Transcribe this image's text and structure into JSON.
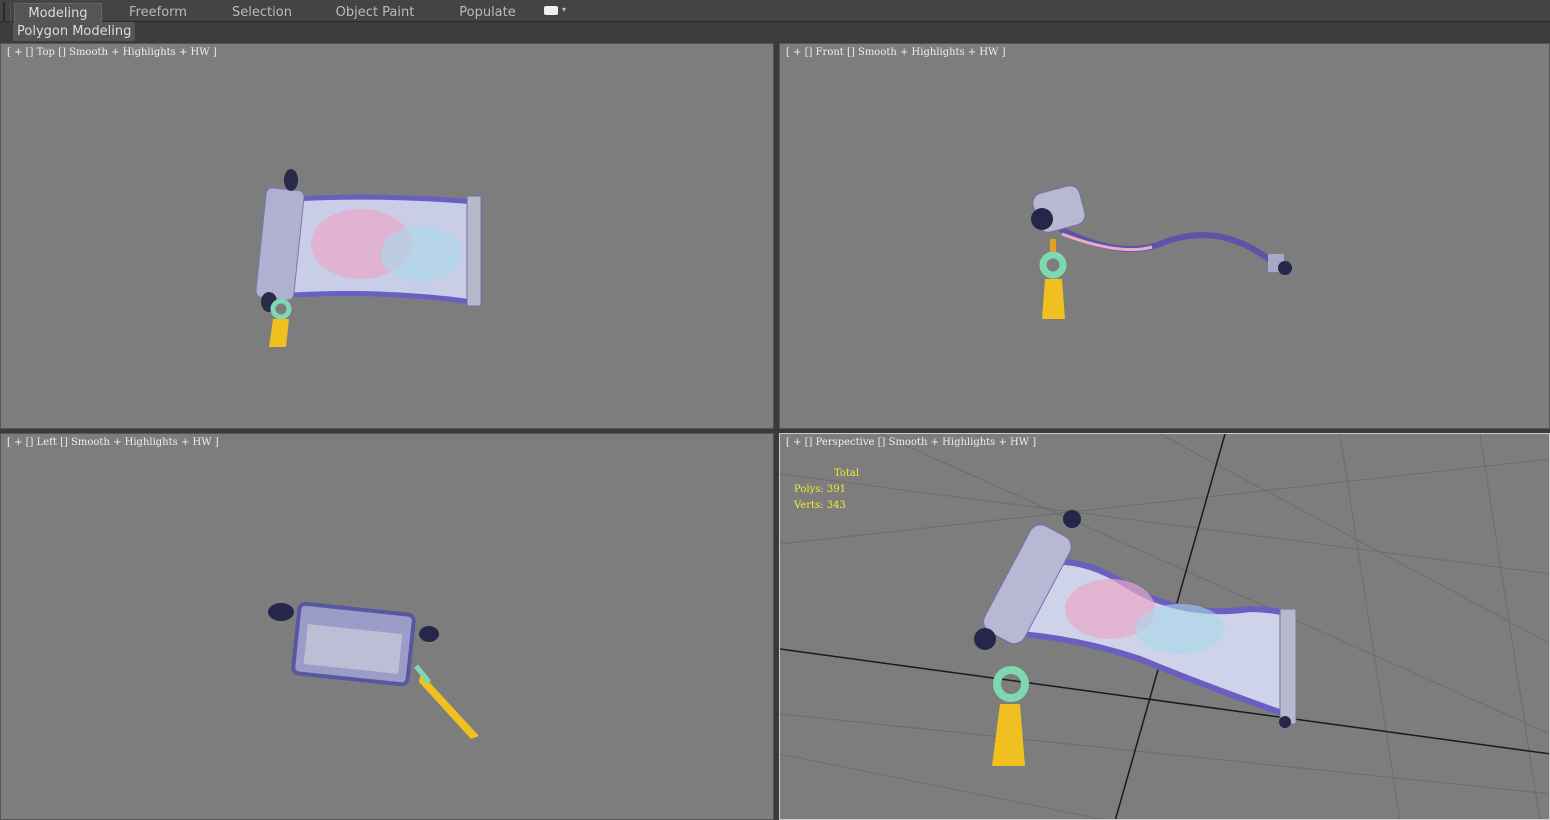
{
  "ribbon": {
    "tabs": [
      "Modeling",
      "Freeform",
      "Selection",
      "Object Paint",
      "Populate"
    ],
    "active": "Modeling",
    "subtab": "Polygon Modeling"
  },
  "viewports": {
    "top": "[ + [] Top [] Smooth + Highlights + HW ]",
    "front": "[ + [] Front [] Smooth + Highlights + HW ]",
    "left": "[ + [] Left [] Smooth + Highlights + HW ]",
    "perspective": "[ + [] Perspective [] Smooth + Highlights + HW ]"
  },
  "stats": {
    "title": "Total",
    "polys": "Polys: 391",
    "verts": "Verts: 343"
  },
  "colors": {
    "viewport_bg": "#7d7d7d",
    "stats": "#eeee33"
  }
}
